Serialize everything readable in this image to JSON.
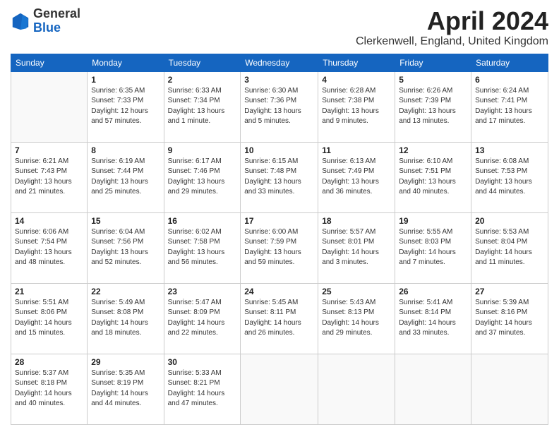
{
  "header": {
    "logo_general": "General",
    "logo_blue": "Blue",
    "month_title": "April 2024",
    "location": "Clerkenwell, England, United Kingdom"
  },
  "days_of_week": [
    "Sunday",
    "Monday",
    "Tuesday",
    "Wednesday",
    "Thursday",
    "Friday",
    "Saturday"
  ],
  "weeks": [
    [
      {
        "day": "",
        "info": ""
      },
      {
        "day": "1",
        "info": "Sunrise: 6:35 AM\nSunset: 7:33 PM\nDaylight: 12 hours\nand 57 minutes."
      },
      {
        "day": "2",
        "info": "Sunrise: 6:33 AM\nSunset: 7:34 PM\nDaylight: 13 hours\nand 1 minute."
      },
      {
        "day": "3",
        "info": "Sunrise: 6:30 AM\nSunset: 7:36 PM\nDaylight: 13 hours\nand 5 minutes."
      },
      {
        "day": "4",
        "info": "Sunrise: 6:28 AM\nSunset: 7:38 PM\nDaylight: 13 hours\nand 9 minutes."
      },
      {
        "day": "5",
        "info": "Sunrise: 6:26 AM\nSunset: 7:39 PM\nDaylight: 13 hours\nand 13 minutes."
      },
      {
        "day": "6",
        "info": "Sunrise: 6:24 AM\nSunset: 7:41 PM\nDaylight: 13 hours\nand 17 minutes."
      }
    ],
    [
      {
        "day": "7",
        "info": "Sunrise: 6:21 AM\nSunset: 7:43 PM\nDaylight: 13 hours\nand 21 minutes."
      },
      {
        "day": "8",
        "info": "Sunrise: 6:19 AM\nSunset: 7:44 PM\nDaylight: 13 hours\nand 25 minutes."
      },
      {
        "day": "9",
        "info": "Sunrise: 6:17 AM\nSunset: 7:46 PM\nDaylight: 13 hours\nand 29 minutes."
      },
      {
        "day": "10",
        "info": "Sunrise: 6:15 AM\nSunset: 7:48 PM\nDaylight: 13 hours\nand 33 minutes."
      },
      {
        "day": "11",
        "info": "Sunrise: 6:13 AM\nSunset: 7:49 PM\nDaylight: 13 hours\nand 36 minutes."
      },
      {
        "day": "12",
        "info": "Sunrise: 6:10 AM\nSunset: 7:51 PM\nDaylight: 13 hours\nand 40 minutes."
      },
      {
        "day": "13",
        "info": "Sunrise: 6:08 AM\nSunset: 7:53 PM\nDaylight: 13 hours\nand 44 minutes."
      }
    ],
    [
      {
        "day": "14",
        "info": "Sunrise: 6:06 AM\nSunset: 7:54 PM\nDaylight: 13 hours\nand 48 minutes."
      },
      {
        "day": "15",
        "info": "Sunrise: 6:04 AM\nSunset: 7:56 PM\nDaylight: 13 hours\nand 52 minutes."
      },
      {
        "day": "16",
        "info": "Sunrise: 6:02 AM\nSunset: 7:58 PM\nDaylight: 13 hours\nand 56 minutes."
      },
      {
        "day": "17",
        "info": "Sunrise: 6:00 AM\nSunset: 7:59 PM\nDaylight: 13 hours\nand 59 minutes."
      },
      {
        "day": "18",
        "info": "Sunrise: 5:57 AM\nSunset: 8:01 PM\nDaylight: 14 hours\nand 3 minutes."
      },
      {
        "day": "19",
        "info": "Sunrise: 5:55 AM\nSunset: 8:03 PM\nDaylight: 14 hours\nand 7 minutes."
      },
      {
        "day": "20",
        "info": "Sunrise: 5:53 AM\nSunset: 8:04 PM\nDaylight: 14 hours\nand 11 minutes."
      }
    ],
    [
      {
        "day": "21",
        "info": "Sunrise: 5:51 AM\nSunset: 8:06 PM\nDaylight: 14 hours\nand 15 minutes."
      },
      {
        "day": "22",
        "info": "Sunrise: 5:49 AM\nSunset: 8:08 PM\nDaylight: 14 hours\nand 18 minutes."
      },
      {
        "day": "23",
        "info": "Sunrise: 5:47 AM\nSunset: 8:09 PM\nDaylight: 14 hours\nand 22 minutes."
      },
      {
        "day": "24",
        "info": "Sunrise: 5:45 AM\nSunset: 8:11 PM\nDaylight: 14 hours\nand 26 minutes."
      },
      {
        "day": "25",
        "info": "Sunrise: 5:43 AM\nSunset: 8:13 PM\nDaylight: 14 hours\nand 29 minutes."
      },
      {
        "day": "26",
        "info": "Sunrise: 5:41 AM\nSunset: 8:14 PM\nDaylight: 14 hours\nand 33 minutes."
      },
      {
        "day": "27",
        "info": "Sunrise: 5:39 AM\nSunset: 8:16 PM\nDaylight: 14 hours\nand 37 minutes."
      }
    ],
    [
      {
        "day": "28",
        "info": "Sunrise: 5:37 AM\nSunset: 8:18 PM\nDaylight: 14 hours\nand 40 minutes."
      },
      {
        "day": "29",
        "info": "Sunrise: 5:35 AM\nSunset: 8:19 PM\nDaylight: 14 hours\nand 44 minutes."
      },
      {
        "day": "30",
        "info": "Sunrise: 5:33 AM\nSunset: 8:21 PM\nDaylight: 14 hours\nand 47 minutes."
      },
      {
        "day": "",
        "info": ""
      },
      {
        "day": "",
        "info": ""
      },
      {
        "day": "",
        "info": ""
      },
      {
        "day": "",
        "info": ""
      }
    ]
  ]
}
